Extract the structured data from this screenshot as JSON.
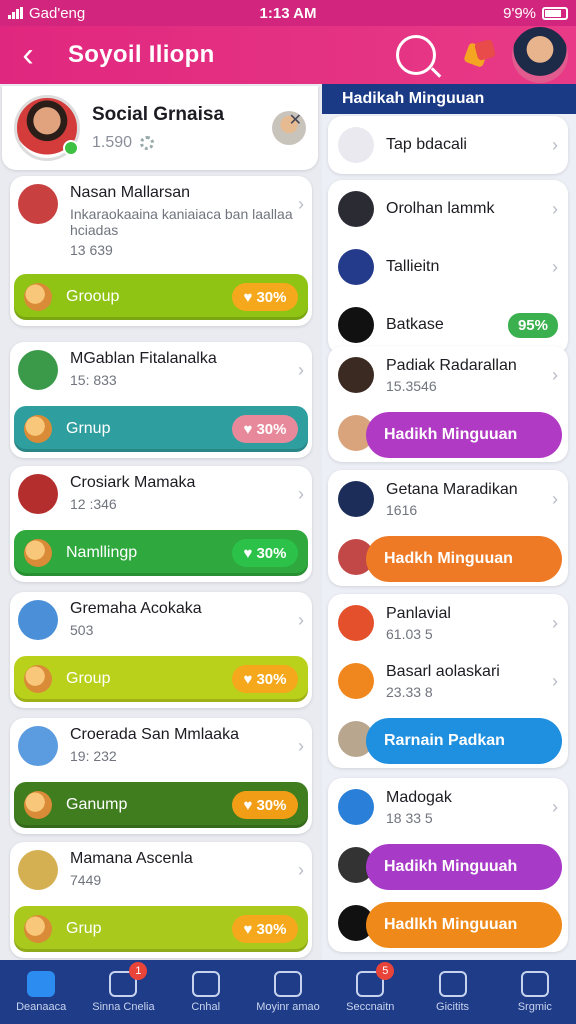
{
  "status_bar": {
    "carrier": "Gad'eng",
    "time": "1:13 AM",
    "battery": "9'9%"
  },
  "header": {
    "title": "Soyoil Iliopn",
    "back_icon": "back-arrow-icon",
    "search_icon": "search-icon",
    "puzzle_icon": "puzzle-icon"
  },
  "profile": {
    "name": "Social Grnaisa",
    "count": "1.590"
  },
  "groups": [
    {
      "name": "Nasan Mallarsan",
      "description": "Inkaraokaaina kaniaiaca ban laallaa hciadas",
      "sub": "13 639",
      "bar_label": "Grooup",
      "pill": "30%",
      "bar_color": "#8fc414",
      "pill_color": "#f6a81c",
      "avatar_color": "#c94040"
    },
    {
      "name": "MGablan Fitalanalka",
      "sub": "15: 833",
      "bar_label": "Grnup",
      "pill": "30%",
      "bar_color": "#2f9e9e",
      "pill_color": "#e8899b",
      "avatar_color": "#3b9a4a"
    },
    {
      "name": "Crosiark Mamaka",
      "sub": "12 :346",
      "bar_label": "Namllingp",
      "pill": "30%",
      "bar_color": "#2fa83d",
      "pill_color": "#2cc24a",
      "avatar_color": "#b52e2e"
    },
    {
      "name": "Gremaha Acokaka",
      "sub": "503",
      "bar_label": "Group",
      "pill": "30%",
      "bar_color": "#b9d11a",
      "pill_color": "#f6a81c",
      "avatar_color": "#4a8fd8"
    },
    {
      "name": "Croerada San Mmlaaka",
      "sub": "19: 232",
      "bar_label": "Ganump",
      "pill": "30%",
      "bar_color": "#3f7d1f",
      "pill_color": "#f29d16",
      "avatar_color": "#5b9be0"
    },
    {
      "name": "Mamana Ascenla",
      "sub": "7449",
      "bar_label": "Grup",
      "pill": "30%",
      "bar_color": "#a9c91c",
      "pill_color": "#f6a81c",
      "avatar_color": "#d4b052"
    }
  ],
  "right_panel": {
    "title": "Hadikah Minguuan",
    "top_item": "Tap bdacali",
    "list1": [
      {
        "name": "Orolhan lammk",
        "icon_color": "#2b2b33"
      },
      {
        "name": "Tallieitn",
        "icon_color": "#243a8a"
      },
      {
        "name": "Batkase",
        "icon_color": "#111",
        "pill": "95%"
      }
    ],
    "list2": [
      {
        "name": "Padiak Radarallan",
        "sub": "15.3546",
        "icon_color": "#3a2a22"
      },
      {
        "action": "Hadikh Minguuan",
        "action_color": "#b13ac4",
        "icon_color": "#d9a47b"
      }
    ],
    "list3": [
      {
        "name": "Getana Maradikan",
        "sub": "1616",
        "icon_color": "#1c2d5a"
      },
      {
        "action": "Hadkh Minguuan",
        "action_color": "#ef7a25",
        "icon_color": "#c24848"
      }
    ],
    "list4": [
      {
        "name": "Panlavial",
        "sub": "61.03 5",
        "icon_color": "#e4502b"
      },
      {
        "name": "Basarl aolaskari",
        "sub": "23.33 8",
        "icon_color": "#f0871e"
      },
      {
        "action": "Rarnain Padkan",
        "action_color": "#1f8fe0",
        "icon_color": "#b9a68e"
      }
    ],
    "list5": [
      {
        "name": "Madogak",
        "sub": "18 33 5",
        "icon_color": "#2a7fd8"
      },
      {
        "action": "Hadikh Minguuah",
        "action_color": "#a83ac8",
        "icon_color": "#333"
      },
      {
        "action": "Hadlkh Minguuan",
        "action_color": "#ef8a1a",
        "icon_color": "#111"
      }
    ]
  },
  "bottom_nav": [
    {
      "label": "Deanaaca",
      "icon": "home-icon",
      "active": true
    },
    {
      "label": "Sinna Cnelia",
      "icon": "link-icon",
      "badge": "1"
    },
    {
      "label": "Cnhal",
      "icon": "heart-icon"
    },
    {
      "label": "Moyinr amao",
      "icon": "list-icon"
    },
    {
      "label": "Seccnaitn",
      "icon": "check-icon",
      "badge": "5"
    },
    {
      "label": "Gicitits",
      "icon": "globe-icon"
    },
    {
      "label": "Srgmic",
      "icon": "person-icon"
    }
  ]
}
